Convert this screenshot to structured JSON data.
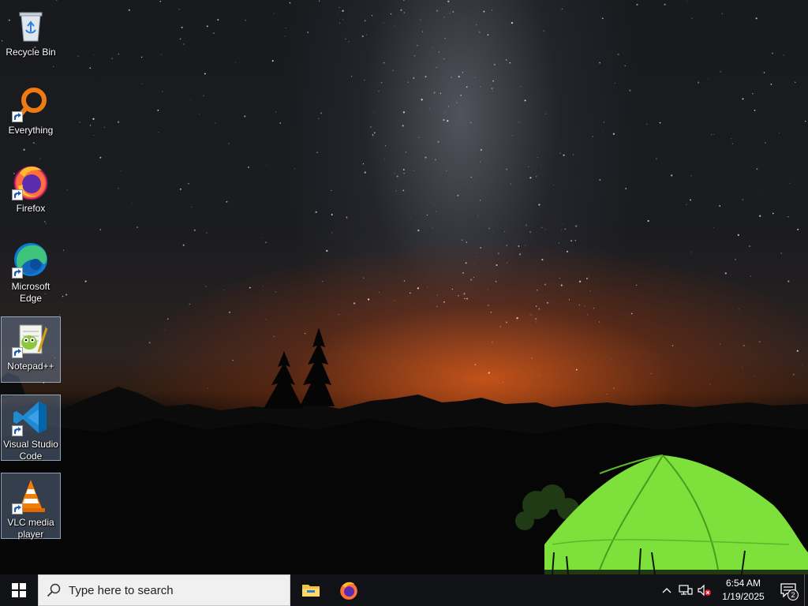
{
  "desktop": {
    "icons": [
      {
        "label": "Recycle Bin",
        "icon": "recycle-bin-icon",
        "shortcut": false,
        "selected": false
      },
      {
        "label": "Everything",
        "icon": "everything-search-icon",
        "shortcut": true,
        "selected": false
      },
      {
        "label": "Firefox",
        "icon": "firefox-icon",
        "shortcut": true,
        "selected": false
      },
      {
        "label": "Microsoft Edge",
        "icon": "edge-icon",
        "shortcut": true,
        "selected": false
      },
      {
        "label": "Notepad++",
        "icon": "notepadpp-icon",
        "shortcut": true,
        "selected": true
      },
      {
        "label": "Visual Studio Code",
        "icon": "vscode-icon",
        "shortcut": true,
        "selected": true
      },
      {
        "label": "VLC media player",
        "icon": "vlc-icon",
        "shortcut": true,
        "selected": true
      }
    ]
  },
  "taskbar": {
    "search_placeholder": "Type here to search",
    "pinned": [
      {
        "name": "File Explorer",
        "icon": "file-explorer-icon"
      },
      {
        "name": "Firefox",
        "icon": "firefox-icon"
      }
    ],
    "clock": {
      "time": "6:54 AM",
      "date": "1/19/2025"
    },
    "notification_count": "2"
  },
  "colors": {
    "taskbar_bg": "#101216",
    "search_bg": "#f0f0f0",
    "selection": "#8caad2",
    "tent_green": "#7ee03a"
  }
}
